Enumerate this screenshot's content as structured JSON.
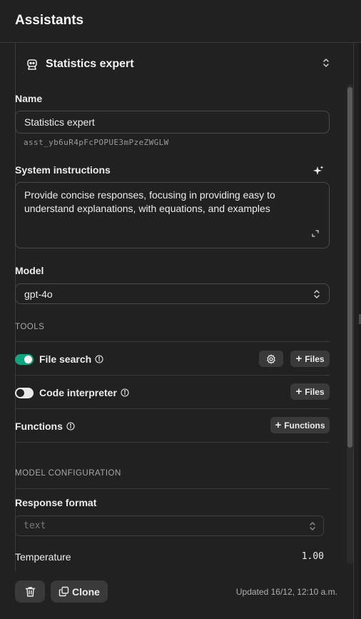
{
  "header": {
    "title": "Assistants"
  },
  "assistant": {
    "name": "Statistics expert",
    "icon": "robot-icon"
  },
  "fields": {
    "name_label": "Name",
    "name_value": "Statistics expert",
    "assistant_id": "asst_yb6uR4pFcPOPUE3mPzeZWGLW",
    "instructions_label": "System instructions",
    "instructions_value": "Provide concise responses, focusing in providing easy to understand explanations, with equations, and examples",
    "model_label": "Model",
    "model_value": "gpt-4o"
  },
  "tools": {
    "section_title": "TOOLS",
    "file_search": {
      "label": "File search",
      "enabled": true,
      "files_button": "Files"
    },
    "code_interpreter": {
      "label": "Code interpreter",
      "enabled": false,
      "files_button": "Files"
    },
    "functions": {
      "label": "Functions",
      "button": "Functions"
    }
  },
  "model_config": {
    "section_title": "MODEL CONFIGURATION",
    "response_format_label": "Response format",
    "response_format_value": "text",
    "temperature_label": "Temperature",
    "temperature_value": "1.00"
  },
  "footer": {
    "clone_label": "Clone",
    "updated_text": "Updated 16/12, 12:10 a.m."
  },
  "colors": {
    "accent": "#10a37f",
    "background": "#212121"
  }
}
